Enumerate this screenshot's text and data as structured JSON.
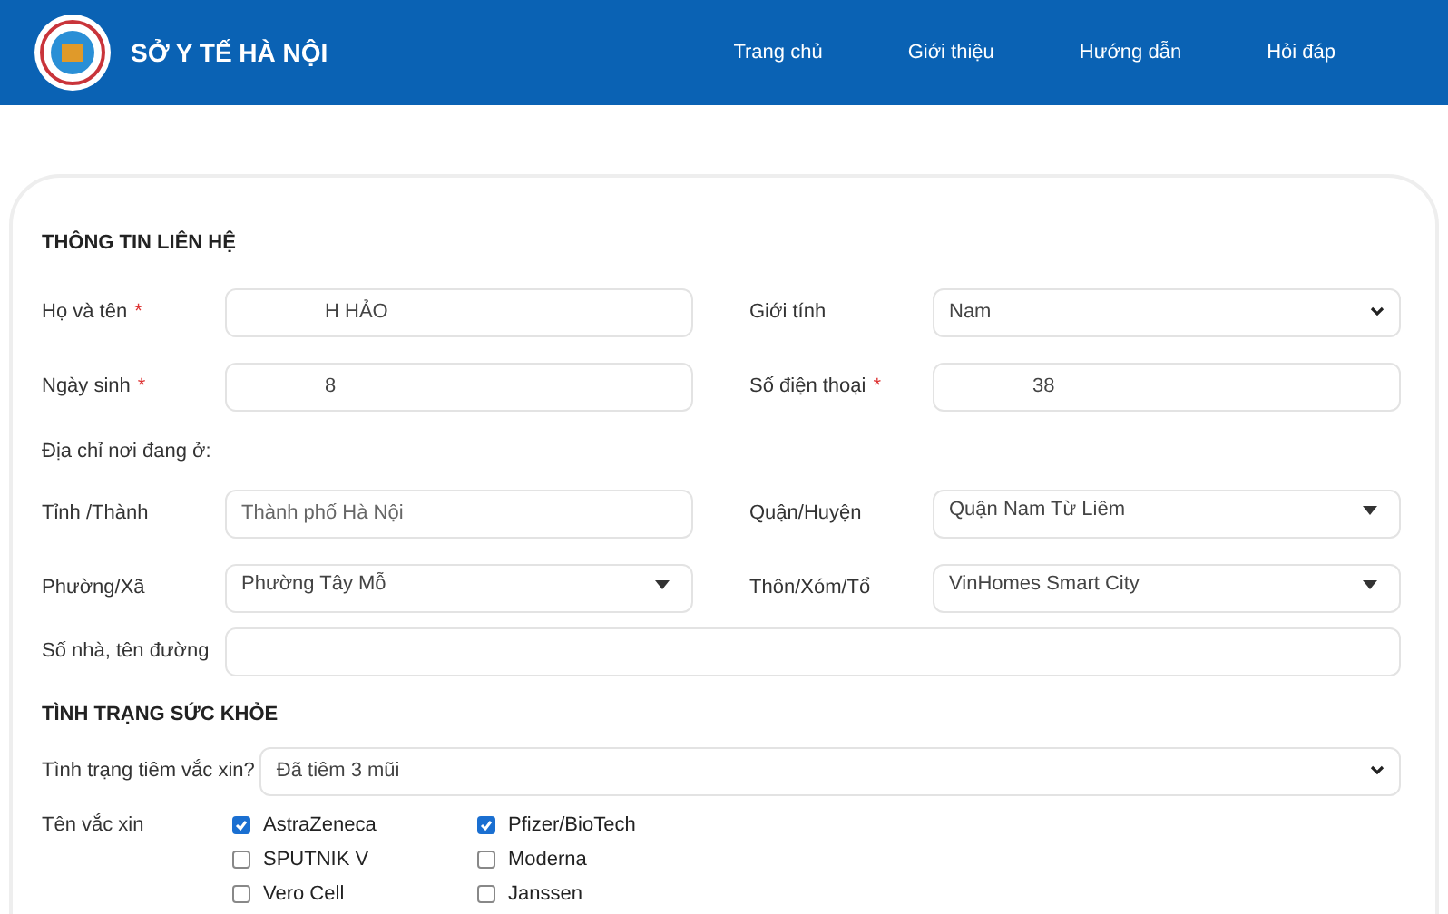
{
  "header": {
    "title": "SỞ Y TẾ HÀ NỘI",
    "nav": [
      {
        "label": "Trang chủ"
      },
      {
        "label": "Giới thiệu"
      },
      {
        "label": "Hướng dẫn"
      },
      {
        "label": "Hỏi đáp"
      }
    ]
  },
  "contact": {
    "title": "THÔNG TIN LIÊN HỆ",
    "rows": [
      [
        {
          "label": "Họ và tên",
          "mark": "*",
          "kind": "input",
          "value": "H HẢO"
        },
        {
          "label": "Giới tính",
          "kind": "select",
          "value": "Nam"
        }
      ],
      [
        {
          "label": "Ngày sinh",
          "mark": "*",
          "kind": "input",
          "value": "8"
        },
        {
          "label": "Số điện thoại",
          "mark": "*",
          "kind": "input",
          "value": "38"
        }
      ]
    ],
    "address_label": "Địa chỉ nơi đang ở:",
    "address_rows": [
      [
        {
          "label": "Tỉnh /Thành",
          "kind": "input",
          "placeholder": "Thành phố Hà Nội"
        },
        {
          "label": "Quận/Huyện",
          "kind": "dropdown",
          "value": "Quận Nam Từ Liêm"
        }
      ],
      [
        {
          "label": "Phường/Xã",
          "kind": "dropdown",
          "value": "Phường Tây Mỗ"
        },
        {
          "label": "Thôn/Xóm/Tổ",
          "kind": "dropdown",
          "value": "VinHomes Smart City"
        }
      ]
    ],
    "street": {
      "label": "Số nhà, tên đường",
      "kind": "input"
    }
  },
  "health": {
    "title": "TÌNH TRẠNG SỨC KHỎE",
    "status": {
      "label": "Tình trạng tiêm vắc xin?",
      "kind": "select",
      "value": "Đã tiêm 3 mũi"
    },
    "vaccine_label": "Tên vắc xin",
    "vaccines": [
      {
        "label": "AstraZeneca",
        "checked": true
      },
      {
        "label": "Pfizer/BioTech",
        "checked": true
      },
      {
        "label": "SPUTNIK V",
        "checked": false
      },
      {
        "label": "Moderna",
        "checked": false
      },
      {
        "label": "Vero Cell",
        "checked": false
      },
      {
        "label": "Janssen",
        "checked": false
      }
    ]
  }
}
